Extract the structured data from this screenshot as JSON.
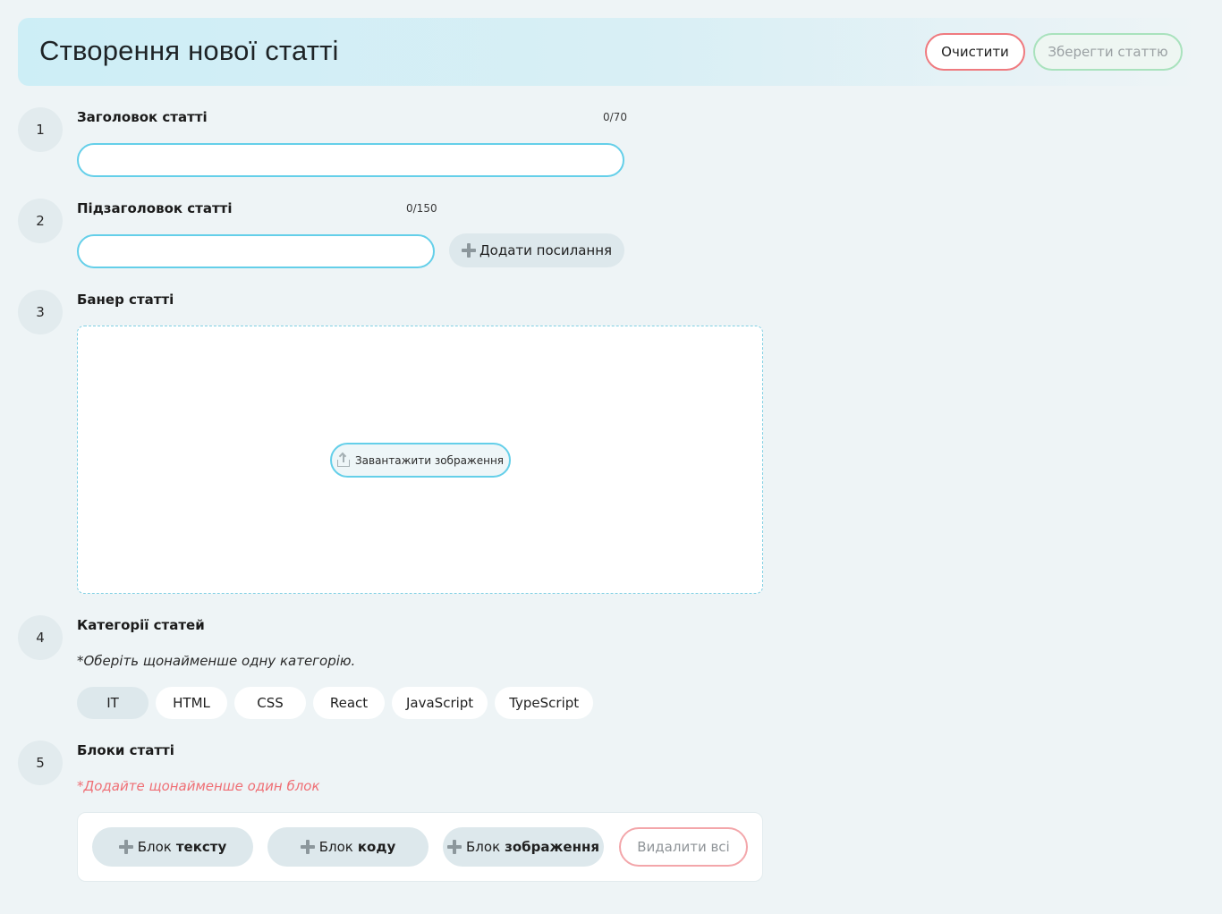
{
  "header": {
    "title": "Створення нової статті",
    "clear_label": "Очистити",
    "save_label": "Зберегти статтю"
  },
  "steps": [
    {
      "number": "1",
      "label": "Заголовок статті",
      "counter": "0/70",
      "value": ""
    },
    {
      "number": "2",
      "label": "Підзаголовок статті",
      "counter": "0/150",
      "value": "",
      "add_link_label": "Додати посилання"
    },
    {
      "number": "3",
      "label": "Банер статті",
      "upload_label": "Завантажити зображення"
    },
    {
      "number": "4",
      "label": "Категорії статей",
      "hint": "*Оберіть щонайменше одну категорію.",
      "categories": [
        "IT",
        "HTML",
        "CSS",
        "React",
        "JavaScript",
        "TypeScript"
      ],
      "selected": "IT"
    },
    {
      "number": "5",
      "label": "Блоки статті",
      "hint": "*Додайте щонайменше один блок",
      "blocks": [
        {
          "prefix": "Блок",
          "bold": "тексту"
        },
        {
          "prefix": "Блок",
          "bold": "коду"
        },
        {
          "prefix": "Блок",
          "bold": "зображення"
        }
      ],
      "delete_all_label": "Видалити всі"
    }
  ],
  "colors": {
    "accent": "#64cfe9",
    "danger": "#ef7a7f",
    "success": "#a9e2bd",
    "background": "#eef4f6"
  }
}
